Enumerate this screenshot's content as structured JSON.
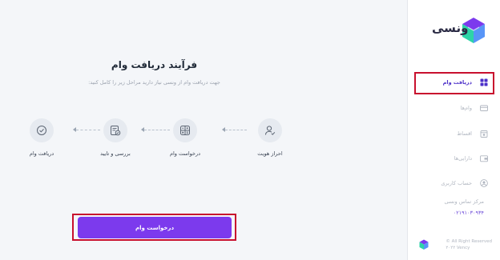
{
  "main": {
    "title": "فرآیند دریافت وام",
    "subtitle": "جهت دریافت وام از ونسی نیاز دارید مراحل زیر را کامل کنید:",
    "steps": [
      {
        "label": "احراز هویت",
        "icon": "user-check-icon"
      },
      {
        "label": "درخواست وام",
        "icon": "grid-calculator-icon"
      },
      {
        "label": "بررسی و تایید",
        "icon": "document-check-icon"
      },
      {
        "label": "دریافت وام",
        "icon": "check-circle-icon"
      }
    ],
    "request_button_label": "درخواست وام"
  },
  "sidebar": {
    "logo_text": "ونسی",
    "items": [
      {
        "label": "دریافت وام",
        "icon": "dashboard-icon",
        "active": true
      },
      {
        "label": "وام‌ها",
        "icon": "card-icon",
        "active": false
      },
      {
        "label": "اقساط",
        "icon": "calendar-icon",
        "active": false
      },
      {
        "label": "دارایی‌ها",
        "icon": "wallet-icon",
        "active": false
      },
      {
        "label": "حساب کاربری",
        "icon": "user-icon",
        "active": false
      }
    ],
    "contact_label": "مرکز تماس ونسی",
    "contact_phone": "۰۲۱۹۱۰۳۰۹۳۴",
    "copyright_line1": "© All Right Reserved",
    "copyright_line2": "۲۰۲۲ Vency"
  },
  "colors": {
    "accent": "#7c3aed",
    "active_nav": "#4b2fc9",
    "highlight": "#c8102e",
    "muted": "#b0b6c0",
    "background": "#f4f6f9"
  }
}
